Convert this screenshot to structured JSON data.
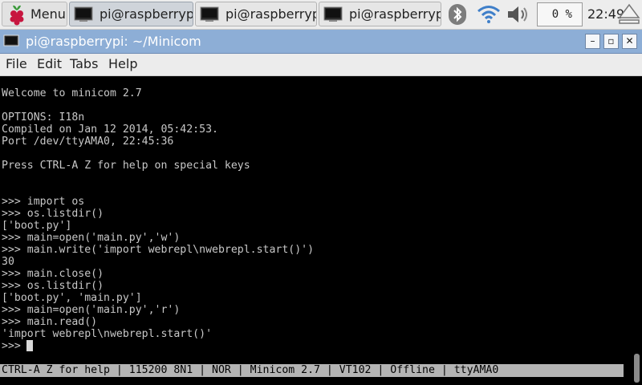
{
  "panel": {
    "menu_label": "Menu",
    "tasks": [
      {
        "label": "pi@raspberrypi..."
      },
      {
        "label": "pi@raspberrypi..."
      },
      {
        "label": "pi@raspberrypi..."
      }
    ],
    "cpu_usage": "0 %",
    "clock": "22:49"
  },
  "window": {
    "title": "pi@raspberrypi: ~/Minicom",
    "buttons": {
      "minimize": "–",
      "maximize": "▫",
      "close": "✕"
    }
  },
  "menubar": {
    "items": [
      "File",
      "Edit",
      "Tabs",
      "Help"
    ]
  },
  "terminal": {
    "lines": [
      "Welcome to minicom 2.7",
      "",
      "OPTIONS: I18n",
      "Compiled on Jan 12 2014, 05:42:53.",
      "Port /dev/ttyAMA0, 22:45:36",
      "",
      "Press CTRL-A Z for help on special keys",
      "",
      "",
      ">>> import os",
      ">>> os.listdir()",
      "['boot.py']",
      ">>> main=open('main.py','w')",
      ">>> main.write('import webrepl\\nwebrepl.start()')",
      "30",
      ">>> main.close()",
      ">>> os.listdir()",
      "['boot.py', 'main.py']",
      ">>> main=open('main.py','r')",
      ">>> main.read()",
      "'import webrepl\\nwebrepl.start()'",
      ">>> "
    ],
    "status_bar": "CTRL-A Z for help | 115200 8N1 | NOR | Minicom 2.7 | VT102 | Offline | ttyAMA0"
  },
  "colors": {
    "titlebar": "#8daed6",
    "terminal_bg": "#000000",
    "terminal_fg": "#c8c8c8",
    "status_bg": "#b4b4b4"
  }
}
